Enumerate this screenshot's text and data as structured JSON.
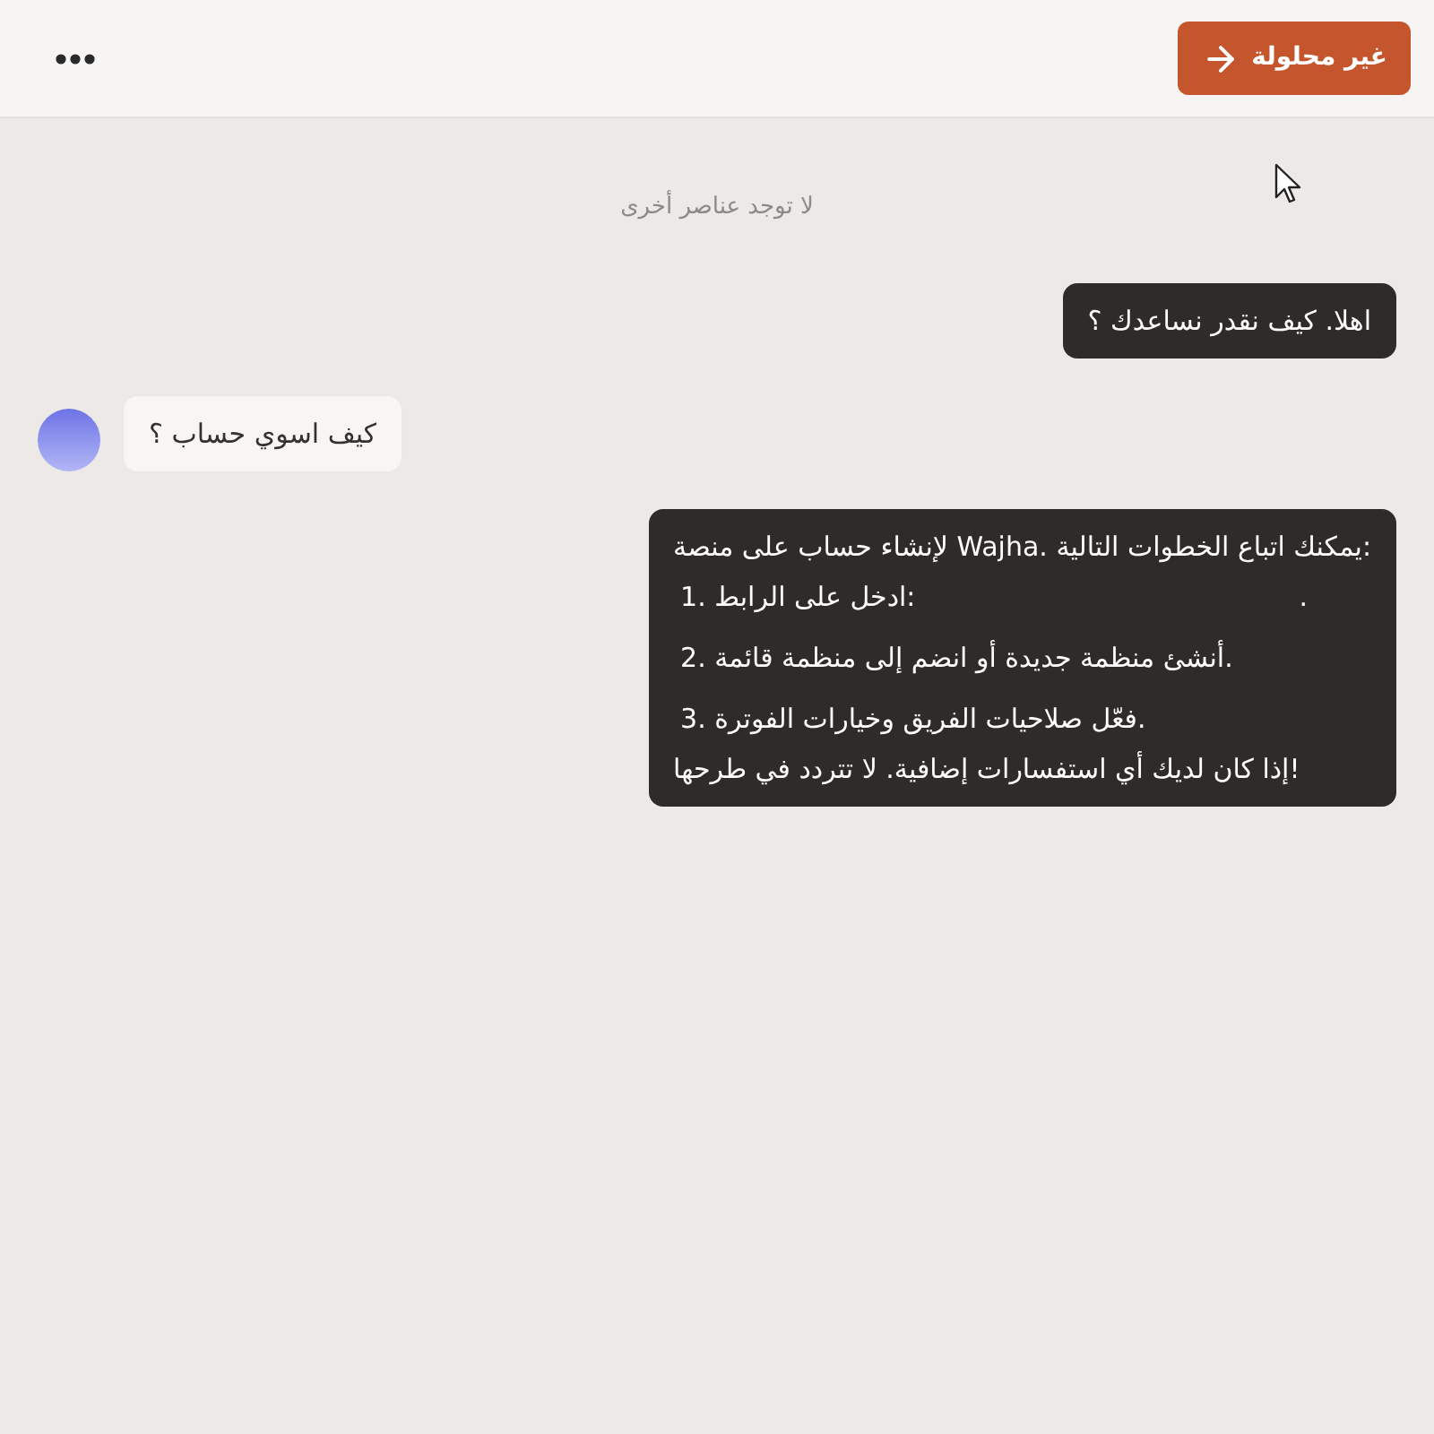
{
  "header": {
    "status_button": {
      "label": "غير محلولة"
    }
  },
  "notice": "لا توجد عناصر أخرى",
  "messages": [
    {
      "kind": "agent",
      "paragraphs": [
        {
          "kind": "text",
          "text": "اهلا. كيف نقدر نساعدك ؟"
        }
      ]
    },
    {
      "kind": "user",
      "paragraphs": [
        {
          "kind": "text",
          "text": "كيف اسوي حساب ؟"
        }
      ]
    },
    {
      "kind": "agent",
      "paragraphs": [
        {
          "kind": "text",
          "text": "لإنشاء حساب على منصة Wajha. يمكنك اتباع الخطوات التالية:"
        },
        {
          "kind": "step",
          "text": "1. ادخل على الرابط:",
          "tail": "."
        },
        {
          "kind": "step",
          "text": "2. أنشئ منظمة جديدة أو انضم إلى منظمة قائمة."
        },
        {
          "kind": "step",
          "text": "3. فعّل صلاحيات الفريق وخيارات الفوترة."
        },
        {
          "kind": "text",
          "text": "إذا كان لديك أي استفسارات إضافية. لا تتردد في طرحها!"
        }
      ]
    }
  ]
}
